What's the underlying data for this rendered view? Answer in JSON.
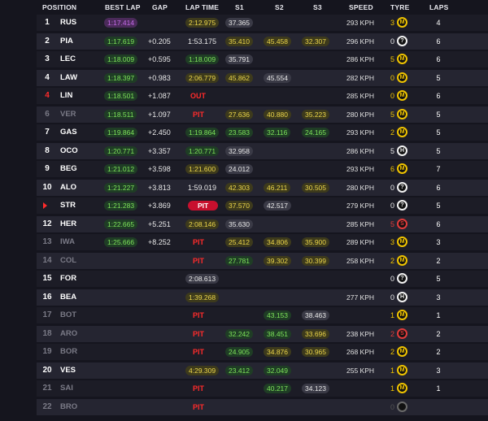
{
  "headers": {
    "position": "POSITION",
    "best_lap": "BEST LAP",
    "gap": "GAP",
    "lap_time": "LAP TIME",
    "s1": "S1",
    "s2": "S2",
    "s3": "S3",
    "speed": "SPEED",
    "tyre": "TYRE",
    "laps": "LAPS"
  },
  "tyre_colors": {
    "M": "#f0c400",
    "H": "#f2f2f2",
    "S": "#e23b3b",
    "?": "#f2f2f2",
    "-": "#6a6a6a"
  },
  "rows": [
    {
      "pos": "1",
      "driver": "RUS",
      "best": "1:17.414",
      "best_c": "p",
      "gap": "",
      "lap": "2:12.975",
      "lap_c": "y",
      "s1": "37.365",
      "s1_c": "w",
      "s2": "",
      "s2_c": "",
      "s3": "",
      "s3_c": "",
      "speed": "293 KPH",
      "tn": "3",
      "tc": "M",
      "laps": "4",
      "state": "normal"
    },
    {
      "pos": "2",
      "driver": "PIA",
      "best": "1:17.619",
      "best_c": "g",
      "gap": "+0.205",
      "lap": "1:53.175",
      "lap_c": "",
      "s1": "35.410",
      "s1_c": "y",
      "s2": "45.458",
      "s2_c": "y",
      "s3": "32.307",
      "s3_c": "y",
      "speed": "296 KPH",
      "tn": "0",
      "tc": "?",
      "laps": "6",
      "state": "normal"
    },
    {
      "pos": "3",
      "driver": "LEC",
      "best": "1:18.009",
      "best_c": "g",
      "gap": "+0.595",
      "lap": "1:18.009",
      "lap_c": "g",
      "s1": "35.791",
      "s1_c": "w",
      "s2": "",
      "s2_c": "",
      "s3": "",
      "s3_c": "",
      "speed": "286 KPH",
      "tn": "5",
      "tc": "M",
      "laps": "6",
      "state": "normal"
    },
    {
      "pos": "4",
      "driver": "LAW",
      "best": "1:18.397",
      "best_c": "g",
      "gap": "+0.983",
      "lap": "2:06.779",
      "lap_c": "y",
      "s1": "45.862",
      "s1_c": "y",
      "s2": "45.554",
      "s2_c": "w",
      "s3": "",
      "s3_c": "",
      "speed": "282 KPH",
      "tn": "0",
      "tc": "M",
      "laps": "5",
      "state": "normal"
    },
    {
      "pos": "4",
      "driver": "LIN",
      "best": "1:18.501",
      "best_c": "g",
      "gap": "+1.087",
      "lap": "OUT",
      "lap_c": "out",
      "s1": "",
      "s1_c": "",
      "s2": "",
      "s2_c": "",
      "s3": "",
      "s3_c": "",
      "speed": "285 KPH",
      "tn": "0",
      "tc": "M",
      "laps": "6",
      "state": "flag"
    },
    {
      "pos": "6",
      "driver": "VER",
      "best": "1:18.511",
      "best_c": "g",
      "gap": "+1.097",
      "lap": "PIT",
      "lap_c": "pit",
      "s1": "27.636",
      "s1_c": "y",
      "s2": "40.880",
      "s2_c": "y",
      "s3": "35.223",
      "s3_c": "y",
      "speed": "280 KPH",
      "tn": "5",
      "tc": "M",
      "laps": "5",
      "state": "dim"
    },
    {
      "pos": "7",
      "driver": "GAS",
      "best": "1:19.864",
      "best_c": "g",
      "gap": "+2.450",
      "lap": "1:19.864",
      "lap_c": "g",
      "s1": "23.583",
      "s1_c": "g",
      "s2": "32.116",
      "s2_c": "g",
      "s3": "24.165",
      "s3_c": "g",
      "speed": "293 KPH",
      "tn": "2",
      "tc": "M",
      "laps": "5",
      "state": "normal"
    },
    {
      "pos": "8",
      "driver": "OCO",
      "best": "1:20.771",
      "best_c": "g",
      "gap": "+3.357",
      "lap": "1:20.771",
      "lap_c": "g",
      "s1": "32.958",
      "s1_c": "w",
      "s2": "",
      "s2_c": "",
      "s3": "",
      "s3_c": "",
      "speed": "286 KPH",
      "tn": "5",
      "tc": "H",
      "laps": "5",
      "state": "normal"
    },
    {
      "pos": "9",
      "driver": "BEG",
      "best": "1:21.012",
      "best_c": "g",
      "gap": "+3.598",
      "lap": "1:21.600",
      "lap_c": "y",
      "s1": "24.012",
      "s1_c": "w",
      "s2": "",
      "s2_c": "",
      "s3": "",
      "s3_c": "",
      "speed": "293 KPH",
      "tn": "6",
      "tc": "M",
      "laps": "7",
      "state": "normal"
    },
    {
      "pos": "10",
      "driver": "ALO",
      "best": "1:21.227",
      "best_c": "g",
      "gap": "+3.813",
      "lap": "1:59.019",
      "lap_c": "",
      "s1": "42.303",
      "s1_c": "y",
      "s2": "46.211",
      "s2_c": "y",
      "s3": "30.505",
      "s3_c": "y",
      "speed": "280 KPH",
      "tn": "0",
      "tc": "?",
      "laps": "6",
      "state": "normal"
    },
    {
      "pos": "",
      "driver": "STR",
      "best": "1:21.283",
      "best_c": "g",
      "gap": "+3.869",
      "lap": "PIT",
      "lap_c": "pitr",
      "s1": "37.570",
      "s1_c": "y",
      "s2": "42.517",
      "s2_c": "w",
      "s3": "",
      "s3_c": "",
      "speed": "279 KPH",
      "tn": "0",
      "tc": "?",
      "laps": "5",
      "state": "flag"
    },
    {
      "pos": "12",
      "driver": "HER",
      "best": "1:22.665",
      "best_c": "g",
      "gap": "+5.251",
      "lap": "2:08.146",
      "lap_c": "y",
      "s1": "35.630",
      "s1_c": "w",
      "s2": "",
      "s2_c": "",
      "s3": "",
      "s3_c": "",
      "speed": "285 KPH",
      "tn": "5",
      "tc": "S",
      "laps": "6",
      "state": "normal"
    },
    {
      "pos": "13",
      "driver": "IWA",
      "best": "1:25.666",
      "best_c": "g",
      "gap": "+8.252",
      "lap": "PIT",
      "lap_c": "pit",
      "s1": "25.412",
      "s1_c": "y",
      "s2": "34.806",
      "s2_c": "y",
      "s3": "35.900",
      "s3_c": "y",
      "speed": "289 KPH",
      "tn": "3",
      "tc": "M",
      "laps": "3",
      "state": "dim"
    },
    {
      "pos": "14",
      "driver": "COL",
      "best": "",
      "best_c": "",
      "gap": "",
      "lap": "PIT",
      "lap_c": "pit",
      "s1": "27.781",
      "s1_c": "g",
      "s2": "39.302",
      "s2_c": "y",
      "s3": "30.399",
      "s3_c": "y",
      "speed": "258 KPH",
      "tn": "2",
      "tc": "M",
      "laps": "2",
      "state": "dim"
    },
    {
      "pos": "15",
      "driver": "FOR",
      "best": "",
      "best_c": "",
      "gap": "",
      "lap": "2:08.613",
      "lap_c": "w",
      "s1": "",
      "s1_c": "",
      "s2": "",
      "s2_c": "",
      "s3": "",
      "s3_c": "",
      "speed": "",
      "tn": "0",
      "tc": "?",
      "laps": "5",
      "state": "normal"
    },
    {
      "pos": "16",
      "driver": "BEA",
      "best": "",
      "best_c": "",
      "gap": "",
      "lap": "1:39.268",
      "lap_c": "y",
      "s1": "",
      "s1_c": "",
      "s2": "",
      "s2_c": "",
      "s3": "",
      "s3_c": "",
      "speed": "277 KPH",
      "tn": "0",
      "tc": "H",
      "laps": "3",
      "state": "normal"
    },
    {
      "pos": "17",
      "driver": "BOT",
      "best": "",
      "best_c": "",
      "gap": "",
      "lap": "PIT",
      "lap_c": "pit",
      "s1": "",
      "s1_c": "",
      "s2": "43.153",
      "s2_c": "g",
      "s3": "38.463",
      "s3_c": "w",
      "speed": "",
      "tn": "1",
      "tc": "M",
      "laps": "1",
      "state": "dim"
    },
    {
      "pos": "18",
      "driver": "ARO",
      "best": "",
      "best_c": "",
      "gap": "",
      "lap": "PIT",
      "lap_c": "pit",
      "s1": "32.242",
      "s1_c": "g",
      "s2": "38.451",
      "s2_c": "g",
      "s3": "33.696",
      "s3_c": "y",
      "speed": "238 KPH",
      "tn": "2",
      "tc": "S",
      "laps": "2",
      "state": "dim"
    },
    {
      "pos": "19",
      "driver": "BOR",
      "best": "",
      "best_c": "",
      "gap": "",
      "lap": "PIT",
      "lap_c": "pit",
      "s1": "24.905",
      "s1_c": "g",
      "s2": "34.876",
      "s2_c": "y",
      "s3": "30.965",
      "s3_c": "y",
      "speed": "268 KPH",
      "tn": "2",
      "tc": "M",
      "laps": "2",
      "state": "dim"
    },
    {
      "pos": "20",
      "driver": "VES",
      "best": "",
      "best_c": "",
      "gap": "",
      "lap": "4:29.309",
      "lap_c": "y",
      "s1": "23.412",
      "s1_c": "g",
      "s2": "32.049",
      "s2_c": "g",
      "s3": "",
      "s3_c": "",
      "speed": "255 KPH",
      "tn": "1",
      "tc": "M",
      "laps": "3",
      "state": "normal"
    },
    {
      "pos": "21",
      "driver": "SAI",
      "best": "",
      "best_c": "",
      "gap": "",
      "lap": "PIT",
      "lap_c": "pit",
      "s1": "",
      "s1_c": "",
      "s2": "40.217",
      "s2_c": "g",
      "s3": "34.123",
      "s3_c": "w",
      "speed": "",
      "tn": "1",
      "tc": "M",
      "laps": "1",
      "state": "dim"
    },
    {
      "pos": "22",
      "driver": "BRO",
      "best": "",
      "best_c": "",
      "gap": "",
      "lap": "PIT",
      "lap_c": "pit",
      "s1": "",
      "s1_c": "",
      "s2": "",
      "s2_c": "",
      "s3": "",
      "s3_c": "",
      "speed": "",
      "tn": "0",
      "tc": "-",
      "laps": "",
      "state": "dim"
    }
  ]
}
